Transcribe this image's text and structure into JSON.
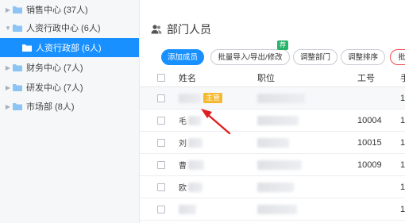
{
  "sidebar": {
    "items": [
      {
        "label": "销售中心 (37人)"
      },
      {
        "label": "人资行政中心 (6人)"
      },
      {
        "label": "人资行政部 (6人)"
      },
      {
        "label": "财务中心 (7人)"
      },
      {
        "label": "研发中心 (7人)"
      },
      {
        "label": "市场部 (8人)"
      }
    ]
  },
  "header": {
    "title": "部门人员"
  },
  "toolbar": {
    "add_label": "添加成员",
    "import_label": "批量导入/导出/修改",
    "import_badge": "荐",
    "dept_label": "调整部门",
    "sort_label": "调整排序",
    "delete_label": "批"
  },
  "table": {
    "headers": [
      "姓名",
      "职位",
      "工号",
      "手"
    ],
    "rows": [
      {
        "name": "",
        "tag": "主管",
        "position": "",
        "job_no": "",
        "phone": "1"
      },
      {
        "name": "毛",
        "tag": "",
        "position": "",
        "job_no": "10004",
        "phone": "1"
      },
      {
        "name": "刘",
        "tag": "",
        "position": "",
        "job_no": "10015",
        "phone": "1"
      },
      {
        "name": "曹",
        "tag": "",
        "position": "",
        "job_no": "10009",
        "phone": "1"
      },
      {
        "name": "欧",
        "tag": "",
        "position": "",
        "job_no": "",
        "phone": "1"
      },
      {
        "name": "",
        "tag": "",
        "position": "",
        "job_no": "",
        "phone": "1"
      }
    ]
  },
  "colors": {
    "accent": "#1890ff",
    "tag": "#f5b82e",
    "badge": "#27b36a",
    "annotation_arrow": "#e02020"
  }
}
